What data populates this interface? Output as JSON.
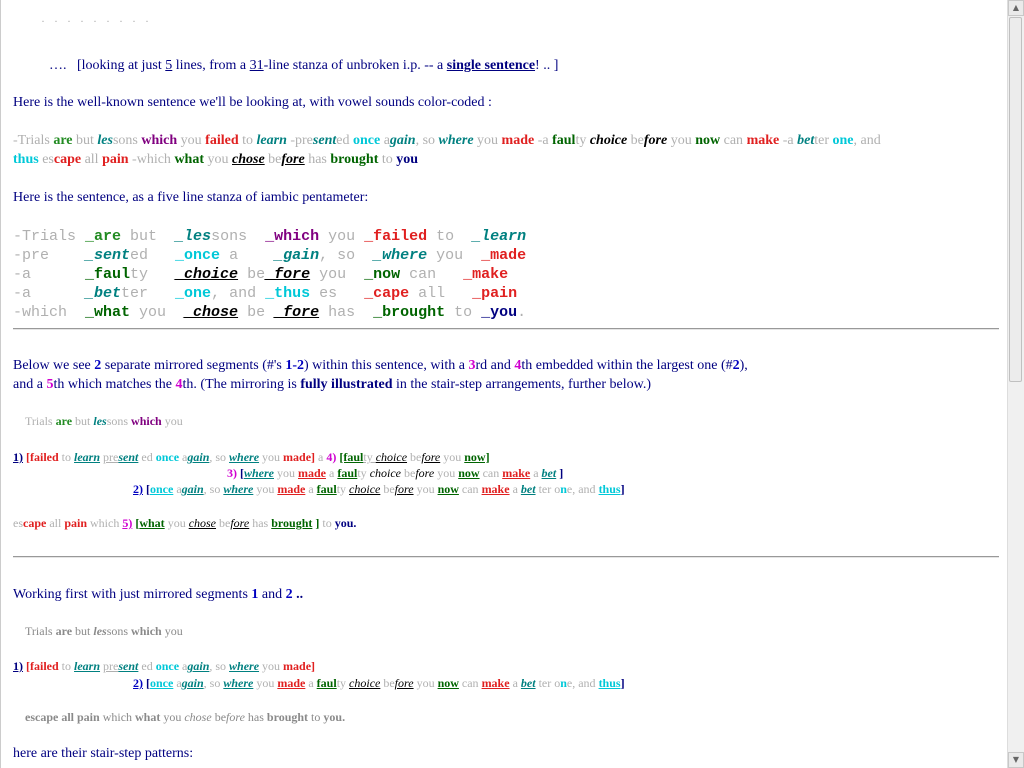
{
  "top_fragment": "· · · · · · · · ·",
  "intro": {
    "lead": "….",
    "pre": "[looking at just",
    "n_lines": "5",
    "mid1": "lines, from a",
    "n_stanza": "31",
    "mid2": "-line stanza of unbroken i.p. -- a",
    "single": "single sentence",
    "tail": "!  .. ]"
  },
  "sentence_heading": "Here is the well-known sentence we'll be looking at, with vowel sounds color-coded :",
  "five_line_heading": "Here is the sentence, as a five line stanza of iambic pentameter:",
  "stanza": [
    [
      {
        "t": "-Trials ",
        "c": "g"
      },
      {
        "t": "_are",
        "c": "grn"
      },
      {
        "t": " but  ",
        "c": "g"
      },
      {
        "t": "_les",
        "c": "tl"
      },
      {
        "t": "sons  ",
        "c": "g"
      },
      {
        "t": "_which",
        "c": "pu"
      },
      {
        "t": " you ",
        "c": "g"
      },
      {
        "t": "_failed",
        "c": "rd"
      },
      {
        "t": " to  ",
        "c": "g"
      },
      {
        "t": "_learn",
        "c": "tl"
      }
    ],
    [
      {
        "t": "-pre    ",
        "c": "g"
      },
      {
        "t": "_sent",
        "c": "tl"
      },
      {
        "t": "ed   ",
        "c": "g"
      },
      {
        "t": "_once",
        "c": "lb"
      },
      {
        "t": " a    ",
        "c": "g"
      },
      {
        "t": "_gain",
        "c": "tl"
      },
      {
        "t": ", so  ",
        "c": "g"
      },
      {
        "t": "_where",
        "c": "tl"
      },
      {
        "t": " you  ",
        "c": "g"
      },
      {
        "t": "_made",
        "c": "rd"
      }
    ],
    [
      {
        "t": "-a      ",
        "c": "g"
      },
      {
        "t": "_faul",
        "c": "dg"
      },
      {
        "t": "ty   ",
        "c": "g"
      },
      {
        "t": "_choice",
        "c": "bk"
      },
      {
        "t": " be",
        "c": "g"
      },
      {
        "t": "_fore",
        "c": "bk"
      },
      {
        "t": " you  ",
        "c": "g"
      },
      {
        "t": "_now",
        "c": "dg"
      },
      {
        "t": " can   ",
        "c": "g"
      },
      {
        "t": "_make",
        "c": "rd"
      }
    ],
    [
      {
        "t": "-a      ",
        "c": "g"
      },
      {
        "t": "_bet",
        "c": "tl"
      },
      {
        "t": "ter   ",
        "c": "g"
      },
      {
        "t": "_one",
        "c": "lb"
      },
      {
        "t": ", and ",
        "c": "g"
      },
      {
        "t": "_thus",
        "c": "lb"
      },
      {
        "t": " es   ",
        "c": "g"
      },
      {
        "t": "_cape",
        "c": "rd"
      },
      {
        "t": " all   ",
        "c": "g"
      },
      {
        "t": "_pain",
        "c": "rd"
      }
    ],
    [
      {
        "t": "-which  ",
        "c": "g"
      },
      {
        "t": "_what",
        "c": "dg"
      },
      {
        "t": " you  ",
        "c": "g"
      },
      {
        "t": "_chose",
        "c": "bk"
      },
      {
        "t": " be ",
        "c": "g"
      },
      {
        "t": "_fore",
        "c": "bk"
      },
      {
        "t": " has  ",
        "c": "g"
      },
      {
        "t": "_brought",
        "c": "dg"
      },
      {
        "t": " to ",
        "c": "g"
      },
      {
        "t": "_you",
        "c": "nv"
      },
      {
        "t": ".",
        "c": "g"
      }
    ]
  ],
  "below": {
    "a": "Below we see",
    "n2": "2",
    "b": "separate mirrored segments (#'s",
    "r": "1-2",
    "c": ") within this sentence, with a",
    "n3": "3",
    "d": "rd and",
    "n4": "4",
    "e": "th embedded within the largest one (#",
    "n2b": "2",
    "f": "),",
    "g": "and a",
    "n5": "5",
    "h": "th which matches the",
    "n4b": "4",
    "i": "th. (The mirroring is",
    "fully": "fully illustrated",
    "j": "in the stair-step arrangements, further below.)"
  },
  "working_heading": {
    "a": "Working first with just mirrored segments",
    "n1": "1",
    "and": "and",
    "n2": "2",
    "tail": ".."
  },
  "stair_heading": "here are their stair-step patterns:",
  "seg_labels": {
    "s1": "1)",
    "s2": "2)",
    "s3": "3)",
    "s4": "4)",
    "s5": "5)"
  }
}
